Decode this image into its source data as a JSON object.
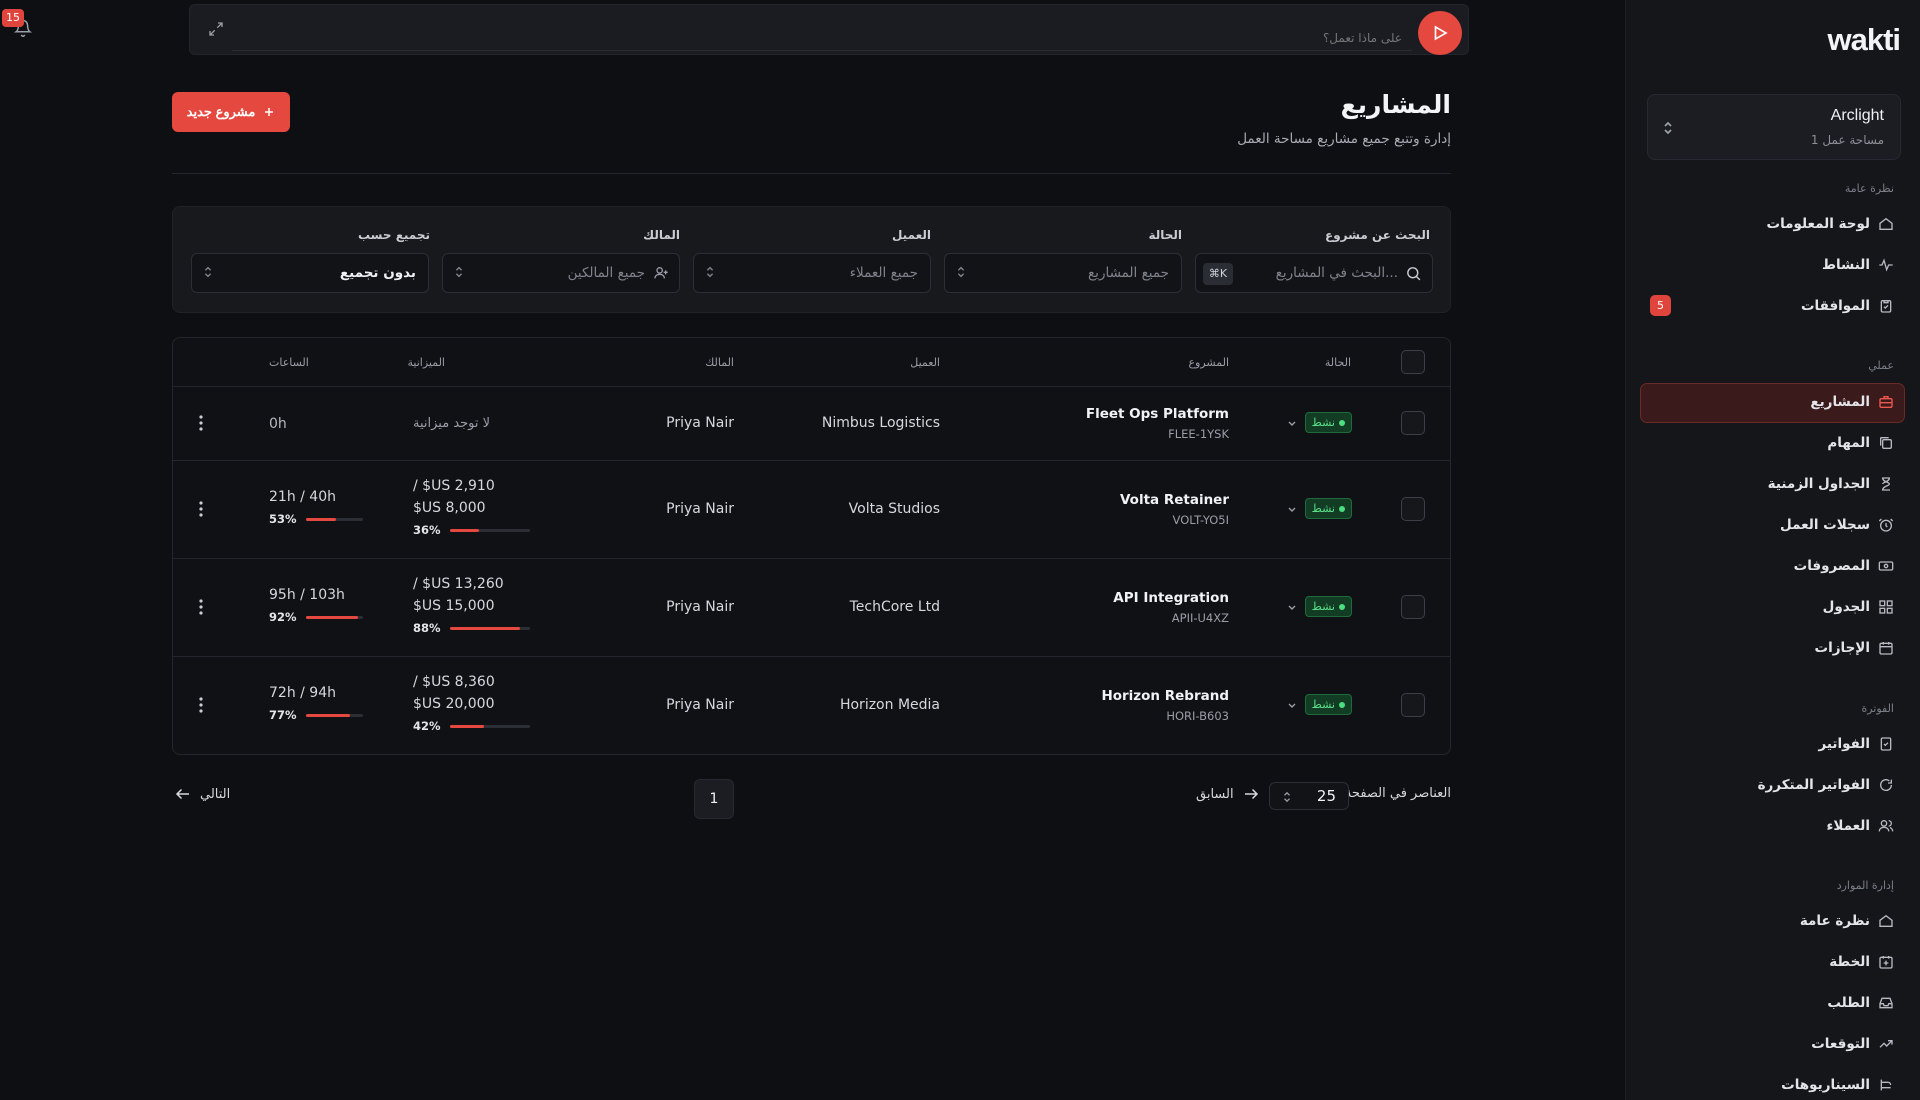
{
  "app": {
    "logo": "wakti"
  },
  "topbar": {
    "placeholder": "على ماذا تعمل؟",
    "notification_count": "15"
  },
  "sidebar": {
    "workspace": {
      "name": "Arclight",
      "subtitle": "1 مساحة عمل"
    },
    "sections": [
      {
        "title": "نظرة عامة",
        "items": [
          {
            "label": "لوحة المعلومات",
            "icon": "home-icon"
          },
          {
            "label": "النشاط",
            "icon": "activity-icon"
          },
          {
            "label": "الموافقات",
            "icon": "clipboard-check-icon",
            "badge": "5"
          }
        ]
      },
      {
        "title": "عملي",
        "items": [
          {
            "label": "المشاريع",
            "icon": "briefcase-icon",
            "active": true
          },
          {
            "label": "المهام",
            "icon": "tasks-icon"
          },
          {
            "label": "الجداول الزمنية",
            "icon": "hourglass-icon"
          },
          {
            "label": "سجلات العمل",
            "icon": "alarm-clock-icon"
          },
          {
            "label": "المصروفات",
            "icon": "money-icon"
          },
          {
            "label": "الجدول",
            "icon": "grid-icon"
          },
          {
            "label": "الإجازات",
            "icon": "calendar-icon"
          }
        ]
      },
      {
        "title": "الفوترة",
        "items": [
          {
            "label": "الفواتير",
            "icon": "invoice-icon"
          },
          {
            "label": "الفواتير المتكررة",
            "icon": "refresh-icon"
          },
          {
            "label": "العملاء",
            "icon": "users-icon"
          }
        ]
      },
      {
        "title": "إدارة الموارد",
        "items": [
          {
            "label": "نظرة عامة",
            "icon": "home-icon"
          },
          {
            "label": "الخطة",
            "icon": "calendar-plus-icon"
          },
          {
            "label": "الطلب",
            "icon": "inbox-icon"
          },
          {
            "label": "التوقعات",
            "icon": "trend-icon"
          },
          {
            "label": "السيناريوهات",
            "icon": "branch-icon"
          }
        ]
      }
    ]
  },
  "header": {
    "title": "المشاريع",
    "subtitle": "إدارة وتتبع جميع مشاريع مساحة العمل",
    "new_button": "مشروع جديد"
  },
  "filters": {
    "search": {
      "label": "البحث عن مشروع",
      "placeholder": "البحث في المشاريع...",
      "shortcut": "⌘K"
    },
    "status": {
      "label": "الحالة",
      "value": "جميع المشاريع"
    },
    "client": {
      "label": "العميل",
      "value": "جميع العملاء"
    },
    "owner": {
      "label": "المالك",
      "value": "جميع المالكين"
    },
    "group": {
      "label": "تجميع حسب",
      "value": "بدون تجميع"
    }
  },
  "table": {
    "headers": {
      "status": "الحالة",
      "project": "المشروع",
      "client": "العميل",
      "owner": "المالك",
      "budget": "الميزانية",
      "hours": "الساعات"
    },
    "rows": [
      {
        "status": "نشط",
        "name": "Fleet Ops Platform",
        "code": "FLEE-1YSK",
        "client": "Nimbus Logistics",
        "owner": "Priya Nair",
        "budget_none": "لا توجد ميزانية",
        "hours": "0h"
      },
      {
        "status": "نشط",
        "name": "Volta Retainer",
        "code": "VOLT-YO5I",
        "client": "Volta Studios",
        "owner": "Priya Nair",
        "budget_line1": "/ $US 2,910",
        "budget_line2": "$US 8,000",
        "budget_pct": "36%",
        "budget_fill": 0.36,
        "hours": "21h / 40h",
        "hours_pct": "53%",
        "hours_fill": 0.53
      },
      {
        "status": "نشط",
        "name": "API Integration",
        "code": "APII-U4XZ",
        "client": "TechCore Ltd",
        "owner": "Priya Nair",
        "budget_line1": "/ $US 13,260",
        "budget_line2": "$US 15,000",
        "budget_pct": "88%",
        "budget_fill": 0.88,
        "hours": "95h / 103h",
        "hours_pct": "92%",
        "hours_fill": 0.92
      },
      {
        "status": "نشط",
        "name": "Horizon Rebrand",
        "code": "HORI-B603",
        "client": "Horizon Media",
        "owner": "Priya Nair",
        "budget_line1": "/ $US 8,360",
        "budget_line2": "$US 20,000",
        "budget_pct": "42%",
        "budget_fill": 0.42,
        "hours": "72h / 94h",
        "hours_pct": "77%",
        "hours_fill": 0.77
      }
    ]
  },
  "pagination": {
    "per_page_label": "العناصر في الصفحة",
    "per_page": "25",
    "prev": "السابق",
    "page": "1",
    "next": "التالي"
  },
  "colors": {
    "accent": "#e5483f",
    "status_green": "#4ade80",
    "background": "#0e0f12",
    "sidebar": "#15161a"
  }
}
